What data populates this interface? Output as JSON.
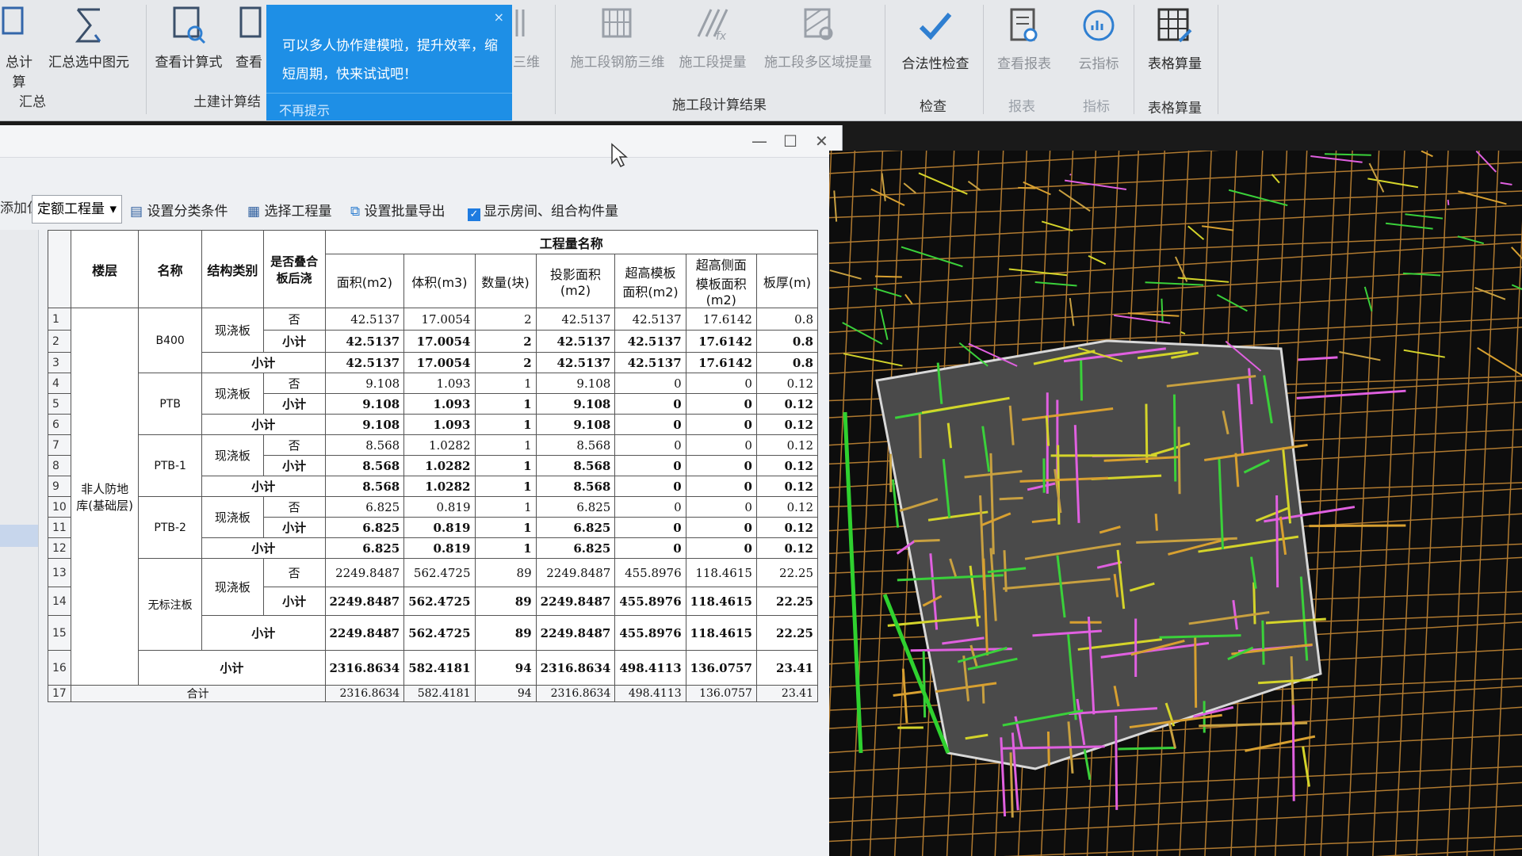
{
  "ribbon": {
    "buttons": [
      {
        "label": "总计算",
        "icon": "calculator-icon"
      },
      {
        "label": "汇总选中图元",
        "icon": "sum-selected-icon"
      },
      {
        "label": "查看计算式",
        "icon": "view-formula-icon"
      },
      {
        "label": "查看",
        "icon": "view-icon"
      },
      {
        "label": "三维",
        "icon": "3d-icon"
      },
      {
        "label": "施工段钢筋三维",
        "icon": "rebar-3d-icon"
      },
      {
        "label": "施工段提量",
        "icon": "stage-quantity-icon"
      },
      {
        "label": "施工段多区域提量",
        "icon": "multi-area-icon"
      },
      {
        "label": "合法性检查",
        "icon": "checkmark-icon"
      },
      {
        "label": "查看报表",
        "icon": "report-icon"
      },
      {
        "label": "云指标",
        "icon": "cloud-index-icon"
      },
      {
        "label": "表格算量",
        "icon": "table-calc-icon"
      }
    ],
    "groups": {
      "summary": "汇总",
      "civil": "土建计算结",
      "stage_result": "施工段计算结果",
      "check": "检查",
      "report": "报表",
      "index": "指标",
      "table_calc": "表格算量"
    }
  },
  "popup": {
    "message": "可以多人协作建模啦，提升效率，缩短周期，快来试试吧！",
    "dismiss": "不再提示",
    "close": "×"
  },
  "dialog": {
    "subbar_label": "添加位置",
    "toolbar": {
      "dropdown": "定额工程量",
      "set_category": "设置分类条件",
      "select_quantity": "选择工程量",
      "set_batch_export": "设置批量导出",
      "show_rooms": "显示房间、组合构件量"
    }
  },
  "table": {
    "group_header": "工程量名称",
    "headers": [
      "楼层",
      "名称",
      "结构类别",
      "是否叠合板后浇",
      "面积(m2)",
      "体积(m3)",
      "数量(块)",
      "投影面积(m2)",
      "超高模板面积(m2)",
      "超高侧面模板面积(m2)",
      "板厚(m)"
    ],
    "floor": "非人防地库(基础层)",
    "names": [
      "B400",
      "PTB",
      "PTB-1",
      "PTB-2",
      "无标注板"
    ],
    "struct_type": "现浇板",
    "no": "否",
    "subtotal": "小计",
    "total": "合计",
    "rows": [
      {
        "n": "1",
        "v": [
          "42.5137",
          "17.0054",
          "2",
          "42.5137",
          "42.5137",
          "17.6142",
          "0.8"
        ]
      },
      {
        "n": "2",
        "v": [
          "42.5137",
          "17.0054",
          "2",
          "42.5137",
          "42.5137",
          "17.6142",
          "0.8"
        ]
      },
      {
        "n": "3",
        "v": [
          "42.5137",
          "17.0054",
          "2",
          "42.5137",
          "42.5137",
          "17.6142",
          "0.8"
        ]
      },
      {
        "n": "4",
        "v": [
          "9.108",
          "1.093",
          "1",
          "9.108",
          "0",
          "0",
          "0.12"
        ]
      },
      {
        "n": "5",
        "v": [
          "9.108",
          "1.093",
          "1",
          "9.108",
          "0",
          "0",
          "0.12"
        ]
      },
      {
        "n": "6",
        "v": [
          "9.108",
          "1.093",
          "1",
          "9.108",
          "0",
          "0",
          "0.12"
        ]
      },
      {
        "n": "7",
        "v": [
          "8.568",
          "1.0282",
          "1",
          "8.568",
          "0",
          "0",
          "0.12"
        ]
      },
      {
        "n": "8",
        "v": [
          "8.568",
          "1.0282",
          "1",
          "8.568",
          "0",
          "0",
          "0.12"
        ]
      },
      {
        "n": "9",
        "v": [
          "8.568",
          "1.0282",
          "1",
          "8.568",
          "0",
          "0",
          "0.12"
        ]
      },
      {
        "n": "10",
        "v": [
          "6.825",
          "0.819",
          "1",
          "6.825",
          "0",
          "0",
          "0.12"
        ]
      },
      {
        "n": "11",
        "v": [
          "6.825",
          "0.819",
          "1",
          "6.825",
          "0",
          "0",
          "0.12"
        ]
      },
      {
        "n": "12",
        "v": [
          "6.825",
          "0.819",
          "1",
          "6.825",
          "0",
          "0",
          "0.12"
        ]
      },
      {
        "n": "13",
        "v": [
          "2249.8487",
          "562.4725",
          "89",
          "2249.8487",
          "455.8976",
          "118.4615",
          "22.25"
        ]
      },
      {
        "n": "14",
        "v": [
          "2249.8487",
          "562.4725",
          "89",
          "2249.8487",
          "455.8976",
          "118.4615",
          "22.25"
        ]
      },
      {
        "n": "15",
        "v": [
          "2249.8487",
          "562.4725",
          "89",
          "2249.8487",
          "455.8976",
          "118.4615",
          "22.25"
        ]
      },
      {
        "n": "16",
        "v": [
          "2316.8634",
          "582.4181",
          "94",
          "2316.8634",
          "498.4113",
          "136.0757",
          "23.41"
        ]
      },
      {
        "n": "17",
        "v": [
          "2316.8634",
          "582.4181",
          "94",
          "2316.8634",
          "498.4113",
          "136.0757",
          "23.41"
        ]
      }
    ]
  },
  "colors": {
    "accent": "#1e8fe6",
    "cad_bg": "#0d0d0d"
  }
}
